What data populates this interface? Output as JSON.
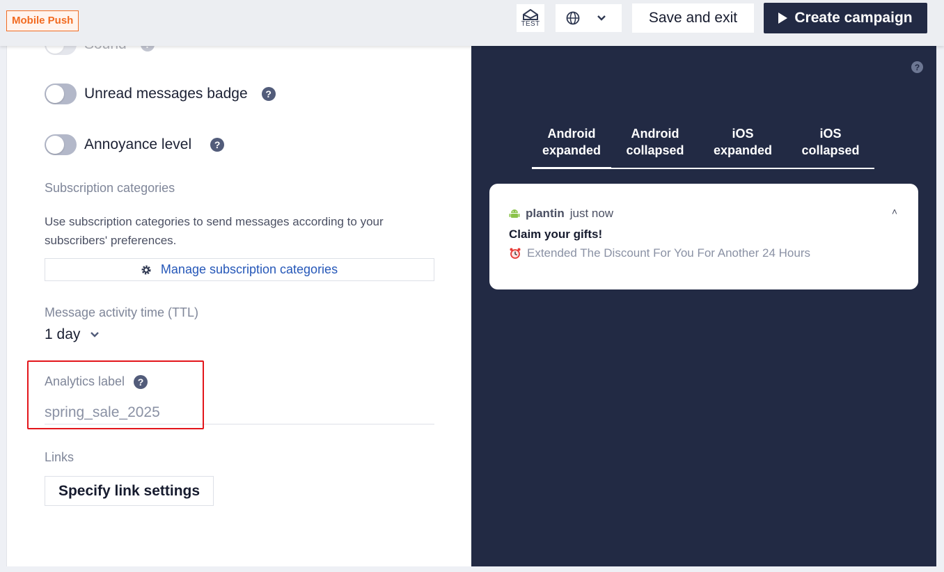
{
  "topbar": {
    "channel": "Mobile Push",
    "test_label": "TEST",
    "save_label": "Save and exit",
    "create_label": "Create campaign"
  },
  "settings": {
    "sound_label": "Sound",
    "badge_label": "Unread messages badge",
    "annoyance_label": "Annoyance level",
    "subscription_heading": "Subscription categories",
    "subscription_desc": "Use subscription categories to send messages according to your subscribers' preferences.",
    "manage_label": "Manage subscription categories",
    "ttl_heading": "Message activity time (TTL)",
    "ttl_value": "1 day",
    "analytics_heading": "Analytics label",
    "analytics_value": "spring_sale_2025",
    "links_heading": "Links",
    "links_button": "Specify link settings"
  },
  "preview": {
    "tabs": [
      {
        "line1": "Android",
        "line2": "expanded"
      },
      {
        "line1": "Android",
        "line2": "collapsed"
      },
      {
        "line1": "iOS",
        "line2": "expanded"
      },
      {
        "line1": "iOS",
        "line2": "collapsed"
      }
    ],
    "notification": {
      "app": "plantin",
      "time": "just now",
      "title": "Claim your gifts!",
      "body": "Extended The Discount For You For Another 24 Hours"
    }
  },
  "colors": {
    "accent": "#f26b21",
    "dark": "#222a44",
    "link": "#2557b8",
    "highlight": "#e3151b"
  }
}
